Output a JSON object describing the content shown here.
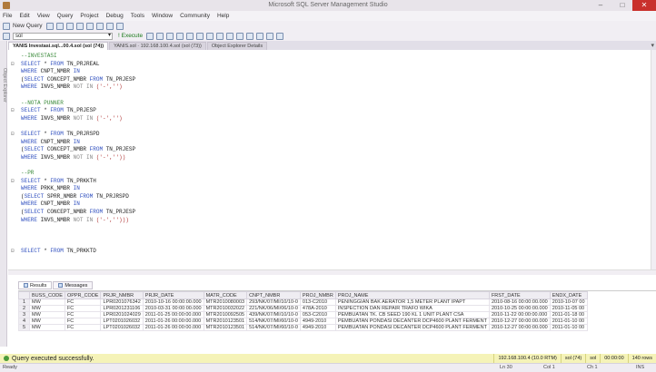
{
  "window": {
    "title": "Microsoft SQL Server Management Studio",
    "minimize": "–",
    "maximize": "□",
    "close": "✕"
  },
  "menu": [
    "File",
    "Edit",
    "View",
    "Query",
    "Project",
    "Debug",
    "Tools",
    "Window",
    "Community",
    "Help"
  ],
  "toolbar": {
    "new_query": "New Query",
    "database": "sol",
    "execute": "! Execute"
  },
  "side_panel": {
    "label": "Object Explorer"
  },
  "doc_tabs": [
    {
      "label": "YANIS Investasi.sql...00.4.sol (sol (74))",
      "active": true
    },
    {
      "label": "YANIS.sol · 192.168.100.4.sol (sol (73))",
      "active": false
    },
    {
      "label": "Object Explorer Details",
      "active": false
    }
  ],
  "editor": {
    "lines": [
      {
        "parts": [
          {
            "t": "--INVESTASI",
            "c": "cm"
          }
        ]
      },
      {
        "parts": [
          {
            "t": "SELECT",
            "c": "kw"
          },
          {
            "t": " * "
          },
          {
            "t": "FROM",
            "c": "kw"
          },
          {
            "t": " TN_PRJREAL"
          }
        ]
      },
      {
        "parts": [
          {
            "t": "WHERE",
            "c": "kw"
          },
          {
            "t": " CNPT_NMBR "
          },
          {
            "t": "IN",
            "c": "kw"
          }
        ]
      },
      {
        "parts": [
          {
            "t": "("
          },
          {
            "t": "SELECT",
            "c": "kw"
          },
          {
            "t": " CONCEPT_NMBR "
          },
          {
            "t": "FROM",
            "c": "kw"
          },
          {
            "t": " TN_PRJESP"
          }
        ]
      },
      {
        "parts": [
          {
            "t": "WHERE",
            "c": "kw"
          },
          {
            "t": " INVS_NMBR "
          },
          {
            "t": "NOT IN",
            "c": "gy"
          },
          {
            "t": " ('-','')",
            "c": "str"
          }
        ]
      },
      {
        "parts": []
      },
      {
        "parts": [
          {
            "t": "--NOTA PUNNER",
            "c": "cm"
          }
        ]
      },
      {
        "parts": [
          {
            "t": "SELECT",
            "c": "kw"
          },
          {
            "t": " * "
          },
          {
            "t": "FROM",
            "c": "kw"
          },
          {
            "t": " TN_PRJESP"
          }
        ]
      },
      {
        "parts": [
          {
            "t": "WHERE",
            "c": "kw"
          },
          {
            "t": " INVS_NMBR "
          },
          {
            "t": "NOT IN",
            "c": "gy"
          },
          {
            "t": " ('-','')",
            "c": "str"
          }
        ]
      },
      {
        "parts": []
      },
      {
        "parts": [
          {
            "t": "SELECT",
            "c": "kw"
          },
          {
            "t": " * "
          },
          {
            "t": "FROM",
            "c": "kw"
          },
          {
            "t": " TN_PRJRSPD"
          }
        ]
      },
      {
        "parts": [
          {
            "t": "WHERE",
            "c": "kw"
          },
          {
            "t": " CNPT_NMBR "
          },
          {
            "t": "IN",
            "c": "kw"
          }
        ]
      },
      {
        "parts": [
          {
            "t": "("
          },
          {
            "t": "SELECT",
            "c": "kw"
          },
          {
            "t": " CONCEPT_NMBR "
          },
          {
            "t": "FROM",
            "c": "kw"
          },
          {
            "t": " TN_PRJESP"
          }
        ]
      },
      {
        "parts": [
          {
            "t": "WHERE",
            "c": "kw"
          },
          {
            "t": " INVS_NMBR "
          },
          {
            "t": "NOT IN",
            "c": "gy"
          },
          {
            "t": " ('-',''))",
            "c": "str"
          }
        ]
      },
      {
        "parts": []
      },
      {
        "parts": [
          {
            "t": "--PR",
            "c": "cm"
          }
        ]
      },
      {
        "parts": [
          {
            "t": "SELECT",
            "c": "kw"
          },
          {
            "t": " * "
          },
          {
            "t": "FROM",
            "c": "kw"
          },
          {
            "t": " TN_PRKKTH"
          }
        ]
      },
      {
        "parts": [
          {
            "t": "WHERE",
            "c": "kw"
          },
          {
            "t": " PRKK_NMBR "
          },
          {
            "t": "IN",
            "c": "kw"
          }
        ]
      },
      {
        "parts": [
          {
            "t": "("
          },
          {
            "t": "SELECT",
            "c": "kw"
          },
          {
            "t": " SPRR_NMBR "
          },
          {
            "t": "FROM",
            "c": "kw"
          },
          {
            "t": " TN_PRJRSPD"
          }
        ]
      },
      {
        "parts": [
          {
            "t": "WHERE",
            "c": "kw"
          },
          {
            "t": " CNPT_NMBR "
          },
          {
            "t": "IN",
            "c": "kw"
          }
        ]
      },
      {
        "parts": [
          {
            "t": "("
          },
          {
            "t": "SELECT",
            "c": "kw"
          },
          {
            "t": " CONCEPT_NMBR "
          },
          {
            "t": "FROM",
            "c": "kw"
          },
          {
            "t": " TN_PRJESP"
          }
        ]
      },
      {
        "parts": [
          {
            "t": "WHERE",
            "c": "kw"
          },
          {
            "t": " INVS_NMBR "
          },
          {
            "t": "NOT IN",
            "c": "gy"
          },
          {
            "t": " ('-','')))",
            "c": "str"
          }
        ]
      },
      {
        "parts": []
      },
      {
        "parts": []
      },
      {
        "parts": []
      },
      {
        "parts": [
          {
            "t": "SELECT",
            "c": "kw"
          },
          {
            "t": " * "
          },
          {
            "t": "FROM",
            "c": "kw"
          },
          {
            "t": " TN_PRKKTD"
          }
        ]
      }
    ],
    "fold_rows": [
      1,
      7,
      10,
      16,
      25
    ]
  },
  "results": {
    "tabs": [
      "Results",
      "Messages"
    ],
    "columns": [
      "",
      "BUSS_CODE",
      "OPPR_CODE",
      "PRJR_NMBR",
      "PRJR_DATE",
      "MATR_CODE",
      "CNPT_NMBR",
      "PROJ_NMBR",
      "PROJ_NAME",
      "FRST_DATE",
      "ENDX_DATE"
    ],
    "rows": [
      [
        "1",
        "MW",
        "FC",
        "LPR0201076342",
        "2010-10-16 00:00:00.000",
        "MTR2010080003",
        "293/NK/07/MI/10/10-0",
        "013-C2010",
        "PENINGGIAN BAK AERATOR 1,5 METER PLANT IPAPT",
        "2010-08-16 00:00:00.000",
        "2010-10-07 00"
      ],
      [
        "2",
        "MW",
        "FC",
        "LPR0201231106",
        "2010-03-31 00:00:00.000",
        "MTR2010032022",
        "221/NK/06/MI/06/10-0",
        "478A-2010",
        "INSPECTION DAN REPAIR TRAFO WIKA",
        "2010-10-25 00:00:00.000",
        "2010-11-05 00"
      ],
      [
        "3",
        "MW",
        "FC",
        "LPR0201024029",
        "2011-01-25 00:00:00.000",
        "MTR2010092505",
        "439/NK/07/MI/10/10-0",
        "053-C2010",
        "PEMBUATAN TK. CB SEED 190 KL 1 UNIT PLANT CSA",
        "2010-11-22 00:00:00.000",
        "2011-01-18 00"
      ],
      [
        "4",
        "MW",
        "FC",
        "LPT0201026032",
        "2011-01-26 00:00:00.000",
        "MTR2010123501",
        "514/NK/07/MI/60/10-0",
        "4949-2010",
        "PEMBUATAN PONDASI DECANTER DCP4600 PLANT FERMENT",
        "2010-12-27 00:00:00.000",
        "2011-01-10 00"
      ],
      [
        "5",
        "MW",
        "FC",
        "LPT0201026032",
        "2011-01-26 00:00:00.000",
        "MTR2010123501",
        "514/NK/07/MI/60/10-0",
        "4949-2010",
        "PEMBUATAN PONDASI DECANTER DCP4600 PLANT FERMENT",
        "2010-12-27 00:00:00.000",
        "2011-01-10 00"
      ]
    ]
  },
  "query_status": {
    "message": "Query executed successfully.",
    "server": "192.168.100.4 (10.0 RTM)",
    "user": "sol (74)",
    "db": "sol",
    "time": "00:00:00",
    "rows": "140 rows"
  },
  "statusbar": {
    "ready": "Ready",
    "ln": "Ln 30",
    "col": "Col 1",
    "ch": "Ch 1",
    "ins": "INS"
  }
}
